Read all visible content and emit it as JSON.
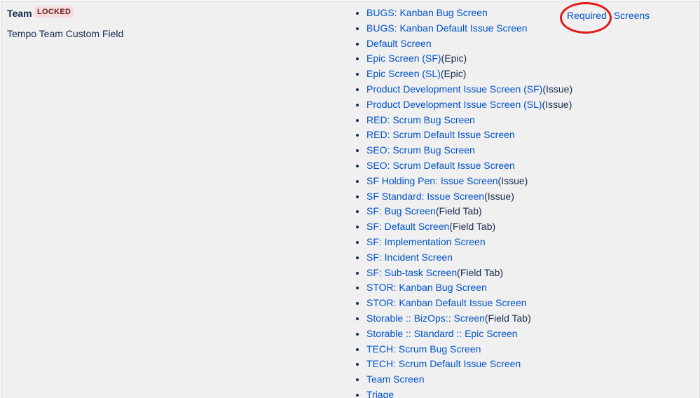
{
  "field": {
    "name": "Team",
    "badge": "LOCKED",
    "description": "Tempo Team Custom Field"
  },
  "actions": {
    "required_label": "Required",
    "screens_label": "Screens"
  },
  "colors": {
    "link": "#0052cc",
    "text": "#172b4d",
    "background": "#f0f0f0",
    "badge_bg": "#f6dcdc",
    "badge_text": "#6b1a1a",
    "annotation": "#e21b1b"
  },
  "screens": [
    {
      "name": "BUGS: Kanban Bug Screen",
      "suffix": ""
    },
    {
      "name": "BUGS: Kanban Default Issue Screen",
      "suffix": ""
    },
    {
      "name": "Default Screen",
      "suffix": ""
    },
    {
      "name": "Epic Screen (SF)",
      "suffix": "(Epic)"
    },
    {
      "name": "Epic Screen (SL)",
      "suffix": "(Epic)"
    },
    {
      "name": "Product Development Issue Screen (SF)",
      "suffix": "(Issue)"
    },
    {
      "name": "Product Development Issue Screen (SL)",
      "suffix": "(Issue)"
    },
    {
      "name": "RED: Scrum Bug Screen",
      "suffix": ""
    },
    {
      "name": "RED: Scrum Default Issue Screen",
      "suffix": ""
    },
    {
      "name": "SEO: Scrum Bug Screen",
      "suffix": ""
    },
    {
      "name": "SEO: Scrum Default Issue Screen",
      "suffix": ""
    },
    {
      "name": "SF Holding Pen: Issue Screen",
      "suffix": "(Issue)"
    },
    {
      "name": "SF Standard: Issue Screen",
      "suffix": "(Issue)"
    },
    {
      "name": "SF: Bug Screen",
      "suffix": "(Field Tab)"
    },
    {
      "name": "SF: Default Screen",
      "suffix": "(Field Tab)"
    },
    {
      "name": "SF: Implementation Screen",
      "suffix": ""
    },
    {
      "name": "SF: Incident Screen",
      "suffix": ""
    },
    {
      "name": "SF: Sub-task Screen",
      "suffix": "(Field Tab)"
    },
    {
      "name": "STOR: Kanban Bug Screen",
      "suffix": ""
    },
    {
      "name": "STOR: Kanban Default Issue Screen",
      "suffix": ""
    },
    {
      "name": "Storable :: BizOps:: Screen",
      "suffix": "(Field Tab)"
    },
    {
      "name": "Storable :: Standard :: Epic Screen",
      "suffix": ""
    },
    {
      "name": "TECH: Scrum Bug Screen",
      "suffix": ""
    },
    {
      "name": "TECH: Scrum Default Issue Screen",
      "suffix": ""
    },
    {
      "name": "Team Screen",
      "suffix": ""
    },
    {
      "name": "Triage",
      "suffix": ""
    }
  ]
}
